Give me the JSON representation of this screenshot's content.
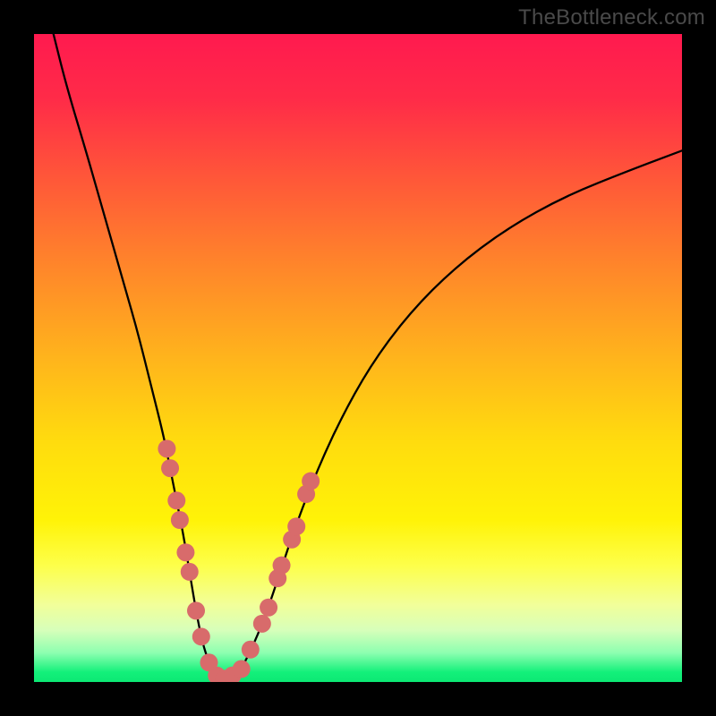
{
  "watermark": "TheBottleneck.com",
  "gradient": {
    "stops": [
      {
        "offset": 0.0,
        "color": "#ff1a4f"
      },
      {
        "offset": 0.1,
        "color": "#ff2b48"
      },
      {
        "offset": 0.22,
        "color": "#ff5639"
      },
      {
        "offset": 0.35,
        "color": "#ff832b"
      },
      {
        "offset": 0.5,
        "color": "#ffb41c"
      },
      {
        "offset": 0.63,
        "color": "#ffdc0e"
      },
      {
        "offset": 0.75,
        "color": "#fff307"
      },
      {
        "offset": 0.82,
        "color": "#fdff4a"
      },
      {
        "offset": 0.88,
        "color": "#f2ff99"
      },
      {
        "offset": 0.92,
        "color": "#d7ffba"
      },
      {
        "offset": 0.955,
        "color": "#8dffb0"
      },
      {
        "offset": 0.985,
        "color": "#13f07a"
      },
      {
        "offset": 1.0,
        "color": "#0ce874"
      }
    ]
  },
  "chart_data": {
    "type": "line",
    "title": "",
    "xlabel": "",
    "ylabel": "",
    "xlim": [
      0,
      100
    ],
    "ylim": [
      0,
      100
    ],
    "grid": false,
    "legend": false,
    "series": [
      {
        "name": "bottleneck-curve",
        "x": [
          3,
          5,
          8,
          10,
          12,
          14,
          16,
          18,
          20,
          21,
          22,
          23,
          24,
          25,
          26,
          27,
          28,
          29,
          30,
          31,
          32,
          34,
          36,
          38,
          40,
          43,
          47,
          52,
          58,
          65,
          73,
          82,
          92,
          100
        ],
        "y": [
          100,
          92,
          82,
          75,
          68,
          61,
          54,
          46,
          38,
          33,
          28,
          23,
          17,
          11,
          6,
          3,
          1,
          0.5,
          0.5,
          1,
          2,
          6,
          11,
          17,
          23,
          31,
          40,
          49,
          57,
          64,
          70,
          75,
          79,
          82
        ]
      }
    ],
    "markers": {
      "name": "highlight-dots",
      "color": "#d86b6b",
      "radius_px": 10,
      "points": [
        {
          "x": 20.5,
          "y": 36
        },
        {
          "x": 21.0,
          "y": 33
        },
        {
          "x": 22.0,
          "y": 28
        },
        {
          "x": 22.5,
          "y": 25
        },
        {
          "x": 23.4,
          "y": 20
        },
        {
          "x": 24.0,
          "y": 17
        },
        {
          "x": 25.0,
          "y": 11
        },
        {
          "x": 25.8,
          "y": 7
        },
        {
          "x": 27.0,
          "y": 3
        },
        {
          "x": 28.2,
          "y": 1
        },
        {
          "x": 29.4,
          "y": 0.5
        },
        {
          "x": 30.6,
          "y": 1
        },
        {
          "x": 32.0,
          "y": 2
        },
        {
          "x": 33.4,
          "y": 5
        },
        {
          "x": 35.2,
          "y": 9
        },
        {
          "x": 36.2,
          "y": 11.5
        },
        {
          "x": 37.6,
          "y": 16
        },
        {
          "x": 38.2,
          "y": 18
        },
        {
          "x": 39.8,
          "y": 22
        },
        {
          "x": 40.5,
          "y": 24
        },
        {
          "x": 42.0,
          "y": 29
        },
        {
          "x": 42.7,
          "y": 31
        }
      ]
    }
  }
}
